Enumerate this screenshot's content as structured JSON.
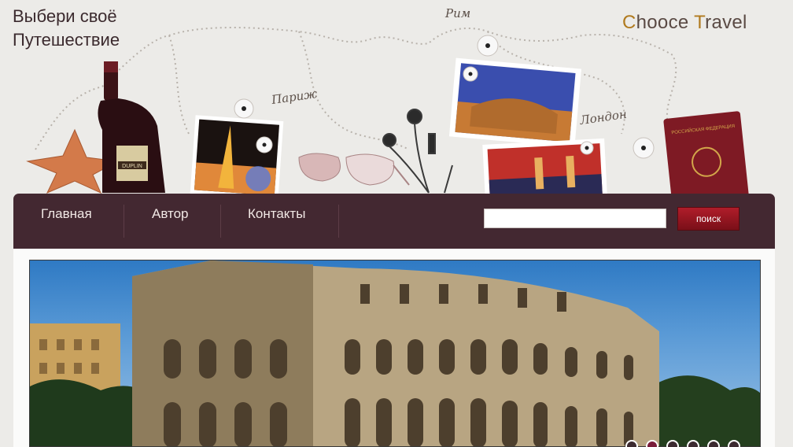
{
  "header": {
    "tagline_line1": "Выбери своё",
    "tagline_line2": "Путешествие",
    "brand_c": "C",
    "brand_part1": "hooce ",
    "brand_t": "T",
    "brand_part2": "ravel",
    "city_labels": {
      "paris": "Париж",
      "rome": "Рим",
      "london": "Лондон"
    },
    "bottle_label": "DUPLIN",
    "passport_label": "РОССИЙСКАЯ ФЕДЕРАЦИЯ"
  },
  "nav": {
    "items": [
      {
        "label": "Главная"
      },
      {
        "label": "Автор"
      },
      {
        "label": "Контакты"
      }
    ]
  },
  "search": {
    "placeholder": "",
    "button_label": "поиск"
  },
  "slider": {
    "total_slides": 6,
    "active_index": 1
  },
  "colors": {
    "nav_bg": "#432831",
    "search_button": "#9a1622",
    "brand_accent": "#b07a1e",
    "page_bg": "#ecebe8"
  }
}
